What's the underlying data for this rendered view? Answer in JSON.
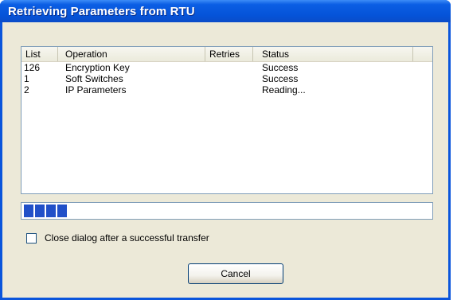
{
  "window": {
    "title": "Retrieving Parameters from RTU"
  },
  "table": {
    "columns": [
      "List",
      "Operation",
      "Retries",
      "Status"
    ],
    "rows": [
      {
        "list": "126",
        "operation": "Encryption Key",
        "retries": "",
        "status": "Success"
      },
      {
        "list": "1",
        "operation": "Soft Switches",
        "retries": "",
        "status": "Success"
      },
      {
        "list": "2",
        "operation": "IP Parameters",
        "retries": "",
        "status": "Reading..."
      }
    ]
  },
  "progress": {
    "value": 0.11,
    "color": "#2150c8"
  },
  "options": {
    "close_after_transfer_label": "Close dialog after a successful transfer",
    "close_after_transfer_checked": false
  },
  "buttons": {
    "cancel_label": "Cancel"
  }
}
